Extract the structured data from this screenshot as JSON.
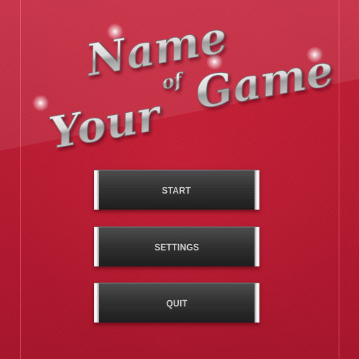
{
  "title": {
    "word1": "Name",
    "word2": "of",
    "word3": "Your",
    "word4": "Game"
  },
  "menu": {
    "items": [
      {
        "label": "START"
      },
      {
        "label": "SETTINGS"
      },
      {
        "label": "QUIT"
      }
    ]
  },
  "colors": {
    "background": "#b81c33",
    "button_face": "#2c2c2c",
    "button_text": "#cfcfcf",
    "chrome_accent": "#ffffff"
  }
}
